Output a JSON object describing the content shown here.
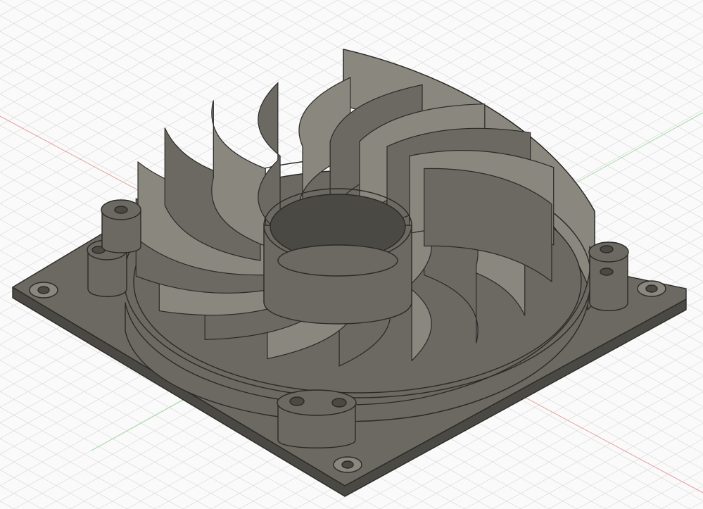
{
  "viewport": {
    "background": "#fafafa",
    "grid_color": "#d6d6d6",
    "x_axis_color": "#e8a0a0",
    "y_axis_color": "#a8dca8"
  },
  "model": {
    "body_color": "#6b6962",
    "body_dark": "#4a4944",
    "body_light": "#8a877f",
    "edge_color": "#2a2a27",
    "blade_count": 18
  }
}
